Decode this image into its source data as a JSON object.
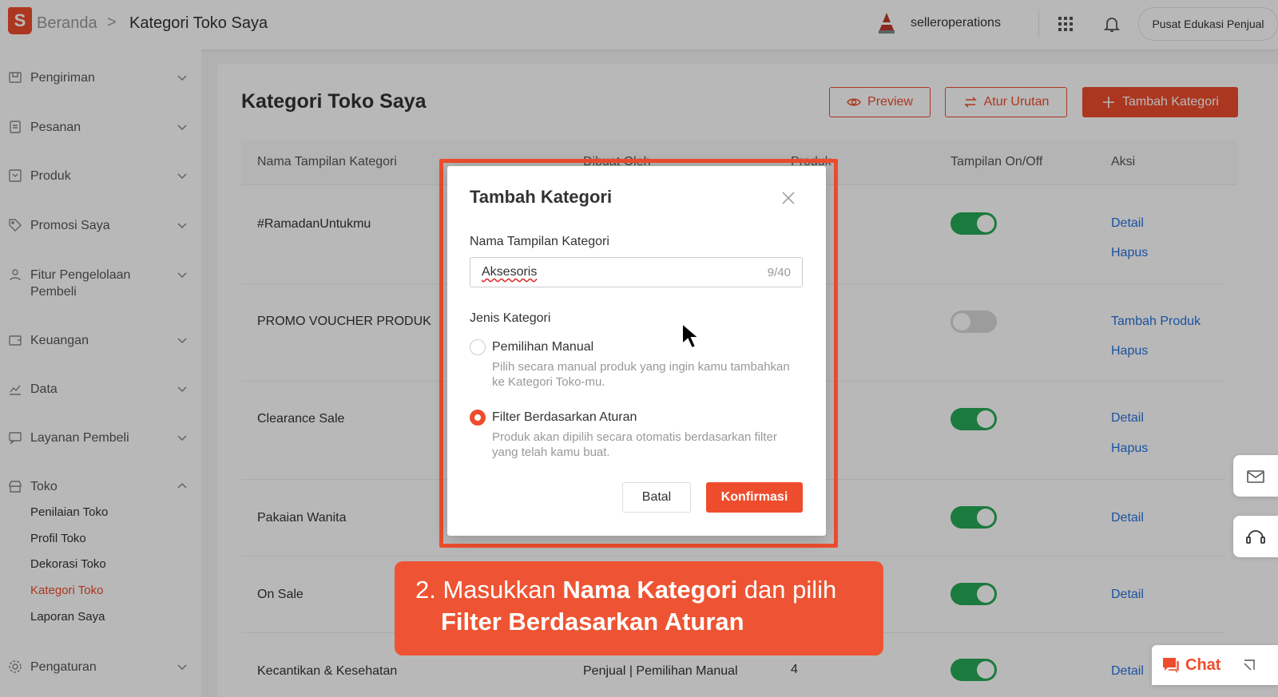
{
  "header": {
    "logo_letter": "S",
    "breadcrumb_home": "Beranda",
    "breadcrumb_sep": ">",
    "breadcrumb_current": "Kategori Toko Saya",
    "username": "selleroperations",
    "education_button": "Pusat Edukasi Penjual"
  },
  "sidebar": {
    "items": [
      {
        "label": "Pengiriman",
        "icon": "truck-icon"
      },
      {
        "label": "Pesanan",
        "icon": "clipboard-icon"
      },
      {
        "label": "Produk",
        "icon": "box-icon"
      },
      {
        "label": "Promosi Saya",
        "icon": "tag-icon"
      },
      {
        "label": "Fitur Pengelolaan Pembeli",
        "icon": "users-icon"
      },
      {
        "label": "Keuangan",
        "icon": "wallet-icon"
      },
      {
        "label": "Data",
        "icon": "chart-icon"
      },
      {
        "label": "Layanan Pembeli",
        "icon": "chat-bubble-icon"
      },
      {
        "label": "Toko",
        "icon": "store-icon"
      },
      {
        "label": "Pengaturan",
        "icon": "gear-icon"
      }
    ],
    "toko_sub": [
      "Penilaian Toko",
      "Profil Toko",
      "Dekorasi Toko",
      "Kategori Toko",
      "Laporan Saya"
    ]
  },
  "main": {
    "title": "Kategori Toko Saya",
    "buttons": {
      "preview": "Preview",
      "sort": "Atur Urutan",
      "add": "Tambah Kategori"
    },
    "columns": [
      "Nama Tampilan Kategori",
      "Dibuat Oleh",
      "Produk",
      "Tampilan On/Off",
      "Aksi"
    ],
    "rows": [
      {
        "name": "#RamadanUntukmu",
        "on": true,
        "actions": [
          "Detail",
          "Hapus"
        ]
      },
      {
        "name": "PROMO VOUCHER PRODUK",
        "on": false,
        "actions": [
          "Tambah Produk",
          "Hapus"
        ]
      },
      {
        "name": "Clearance Sale",
        "on": true,
        "actions": [
          "Detail",
          "Hapus"
        ]
      },
      {
        "name": "Pakaian Wanita",
        "on": true,
        "actions": [
          "Detail"
        ]
      },
      {
        "name": "On Sale",
        "on": true,
        "actions": [
          "Detail"
        ]
      },
      {
        "name": "Kecantikan & Kesehatan",
        "created_by": "Penjual | Pemilihan Manual",
        "count": "4",
        "on": true,
        "actions": [
          "Detail"
        ]
      }
    ]
  },
  "modal": {
    "title": "Tambah Kategori",
    "name_label": "Nama Tampilan Kategori",
    "name_value": "Aksesoris",
    "name_counter": "9/40",
    "type_label": "Jenis Kategori",
    "option_manual": "Pemilihan Manual",
    "option_manual_desc": "Pilih secara manual produk yang ingin kamu tambahkan ke Kategori Toko-mu.",
    "option_filter": "Filter Berdasarkan Aturan",
    "option_filter_desc": "Produk akan dipilih secara otomatis berdasarkan filter yang telah kamu buat.",
    "selected_option": "Filter Berdasarkan Aturan",
    "cancel": "Batal",
    "confirm": "Konfirmasi"
  },
  "caption": {
    "prefix": "2. Masukkan ",
    "bold1": "Nama Kategori",
    "mid": " dan pilih",
    "bold2": "Filter Berdasarkan Aturan"
  },
  "chat": {
    "label": "Chat"
  },
  "colors": {
    "brand": "#ee4d2d",
    "toggle_on": "#26aa55",
    "link": "#2673dd"
  }
}
